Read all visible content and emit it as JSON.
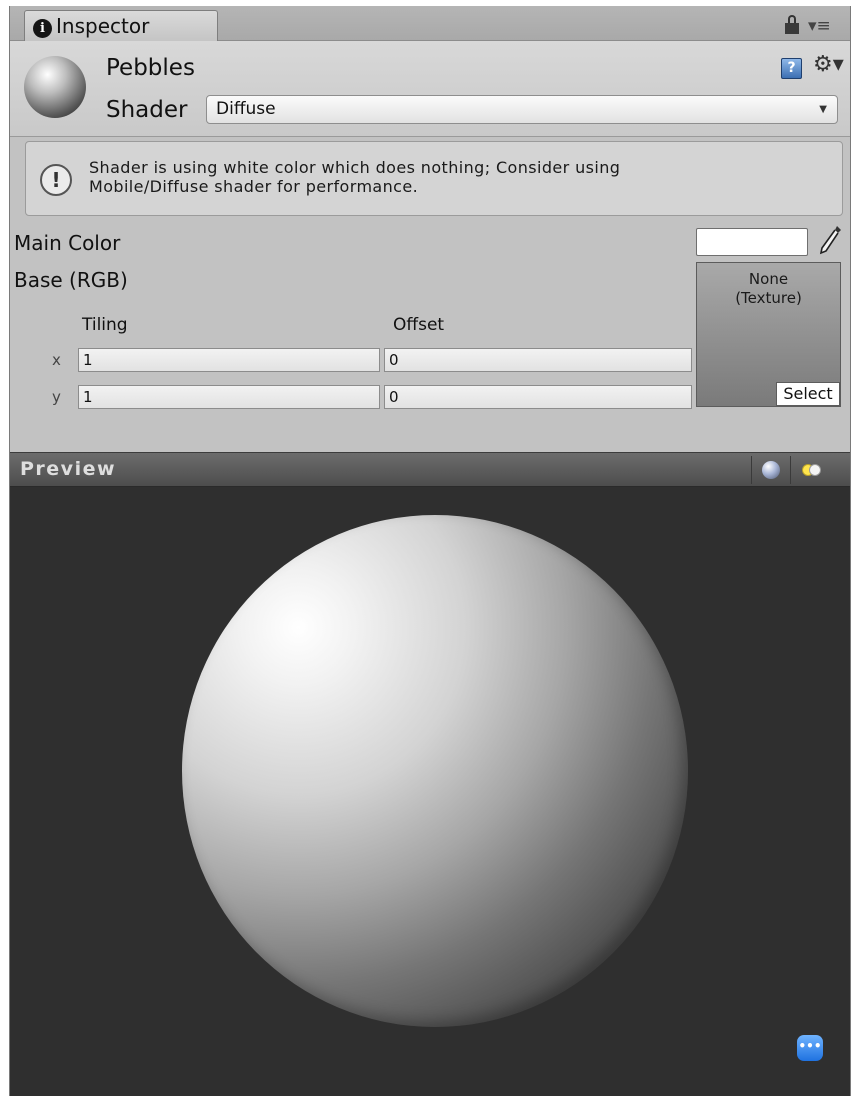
{
  "window": {
    "tab_title": "Inspector"
  },
  "material": {
    "name": "Pebbles",
    "shader_label": "Shader",
    "shader_value": "Diffuse"
  },
  "help_box": {
    "line1": "Shader is using white color which does nothing; Consider using",
    "line2": "Mobile/Diffuse shader for performance."
  },
  "properties": {
    "main_color_label": "Main Color",
    "main_color_value": "#ffffff",
    "base_label": "Base (RGB)",
    "texture_none_line1": "None",
    "texture_none_line2": "(Texture)",
    "texture_select": "Select",
    "tiling_label": "Tiling",
    "offset_label": "Offset",
    "x_label": "x",
    "y_label": "y",
    "tiling_x": "1",
    "tiling_y": "1",
    "offset_x": "0",
    "offset_y": "0"
  },
  "preview": {
    "title": "Preview"
  },
  "icons": {
    "info": "info-icon",
    "lock": "lock-icon",
    "tab_menu": "tab-menu-icon",
    "help": "book-help-icon",
    "gear": "gear-icon",
    "warning": "warning-icon",
    "eyedropper": "eyedropper-icon",
    "preview_mesh": "sphere-icon",
    "preview_light": "light-icon",
    "chat": "chat-icon"
  },
  "colors": {
    "panel_bg": "#c2c2c2",
    "preview_bg": "#2f2f2f",
    "preview_bar": "#5a5a5a"
  }
}
